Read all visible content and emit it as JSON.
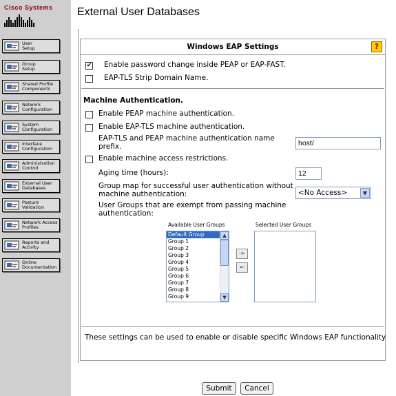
{
  "brand": "Cisco Systems",
  "page_title": "External User Databases",
  "nav": [
    {
      "label": "User\nSetup",
      "icon": "user-setup-icon"
    },
    {
      "label": "Group\nSetup",
      "icon": "group-setup-icon"
    },
    {
      "label": "Shared Profile\nComponents",
      "icon": "shared-profile-icon"
    },
    {
      "label": "Network\nConfiguration",
      "icon": "network-config-icon"
    },
    {
      "label": "System\nConfiguration",
      "icon": "system-config-icon"
    },
    {
      "label": "Interface\nConfiguration",
      "icon": "interface-config-icon"
    },
    {
      "label": "Administration\nControl",
      "icon": "admin-control-icon"
    },
    {
      "label": "External User\nDatabases",
      "icon": "external-db-icon"
    },
    {
      "label": "Posture\nValidation",
      "icon": "posture-icon"
    },
    {
      "label": "Network Access\nProfiles",
      "icon": "nap-icon"
    },
    {
      "label": "Reports and\nActivity",
      "icon": "reports-icon"
    },
    {
      "label": "Online\nDocumentation",
      "icon": "docs-icon"
    }
  ],
  "panel": {
    "title": "Windows EAP Settings",
    "help": "?",
    "opt_password_change": {
      "label": "Enable password change inside PEAP or EAP-FAST.",
      "checked": true
    },
    "opt_strip_domain": {
      "label": "EAP-TLS Strip Domain Name.",
      "checked": false
    },
    "machine_heading": "Machine Authentication.",
    "opt_peap_machine": {
      "label": "Enable PEAP machine authentication.",
      "checked": false
    },
    "opt_tls_machine": {
      "label": "Enable EAP-TLS machine authentication.",
      "checked": false
    },
    "name_prefix_label": "EAP-TLS and PEAP machine authentication name prefix.",
    "name_prefix_value": "host/",
    "opt_access_restrictions": {
      "label": "Enable machine access restrictions.",
      "checked": false
    },
    "aging_label": "Aging time (hours):",
    "aging_value": "12",
    "group_map_label": "Group map for successful user authentication without machine authentication:",
    "group_map_value": "<No Access>",
    "exempt_label": "User Groups that are exempt from passing machine authentication:",
    "available_title": "Available User Groups",
    "selected_title": "Selected User Groups",
    "available_groups": [
      "Default Group",
      "Group 1",
      "Group 2",
      "Group 3",
      "Group 4",
      "Group 5",
      "Group 6",
      "Group 7",
      "Group 8",
      "Group 9"
    ],
    "move_right": "->",
    "move_left": "<-",
    "footer_note": "These settings can be used to enable or disable specific Windows EAP functionality"
  },
  "buttons": {
    "submit": "Submit",
    "cancel": "Cancel"
  }
}
